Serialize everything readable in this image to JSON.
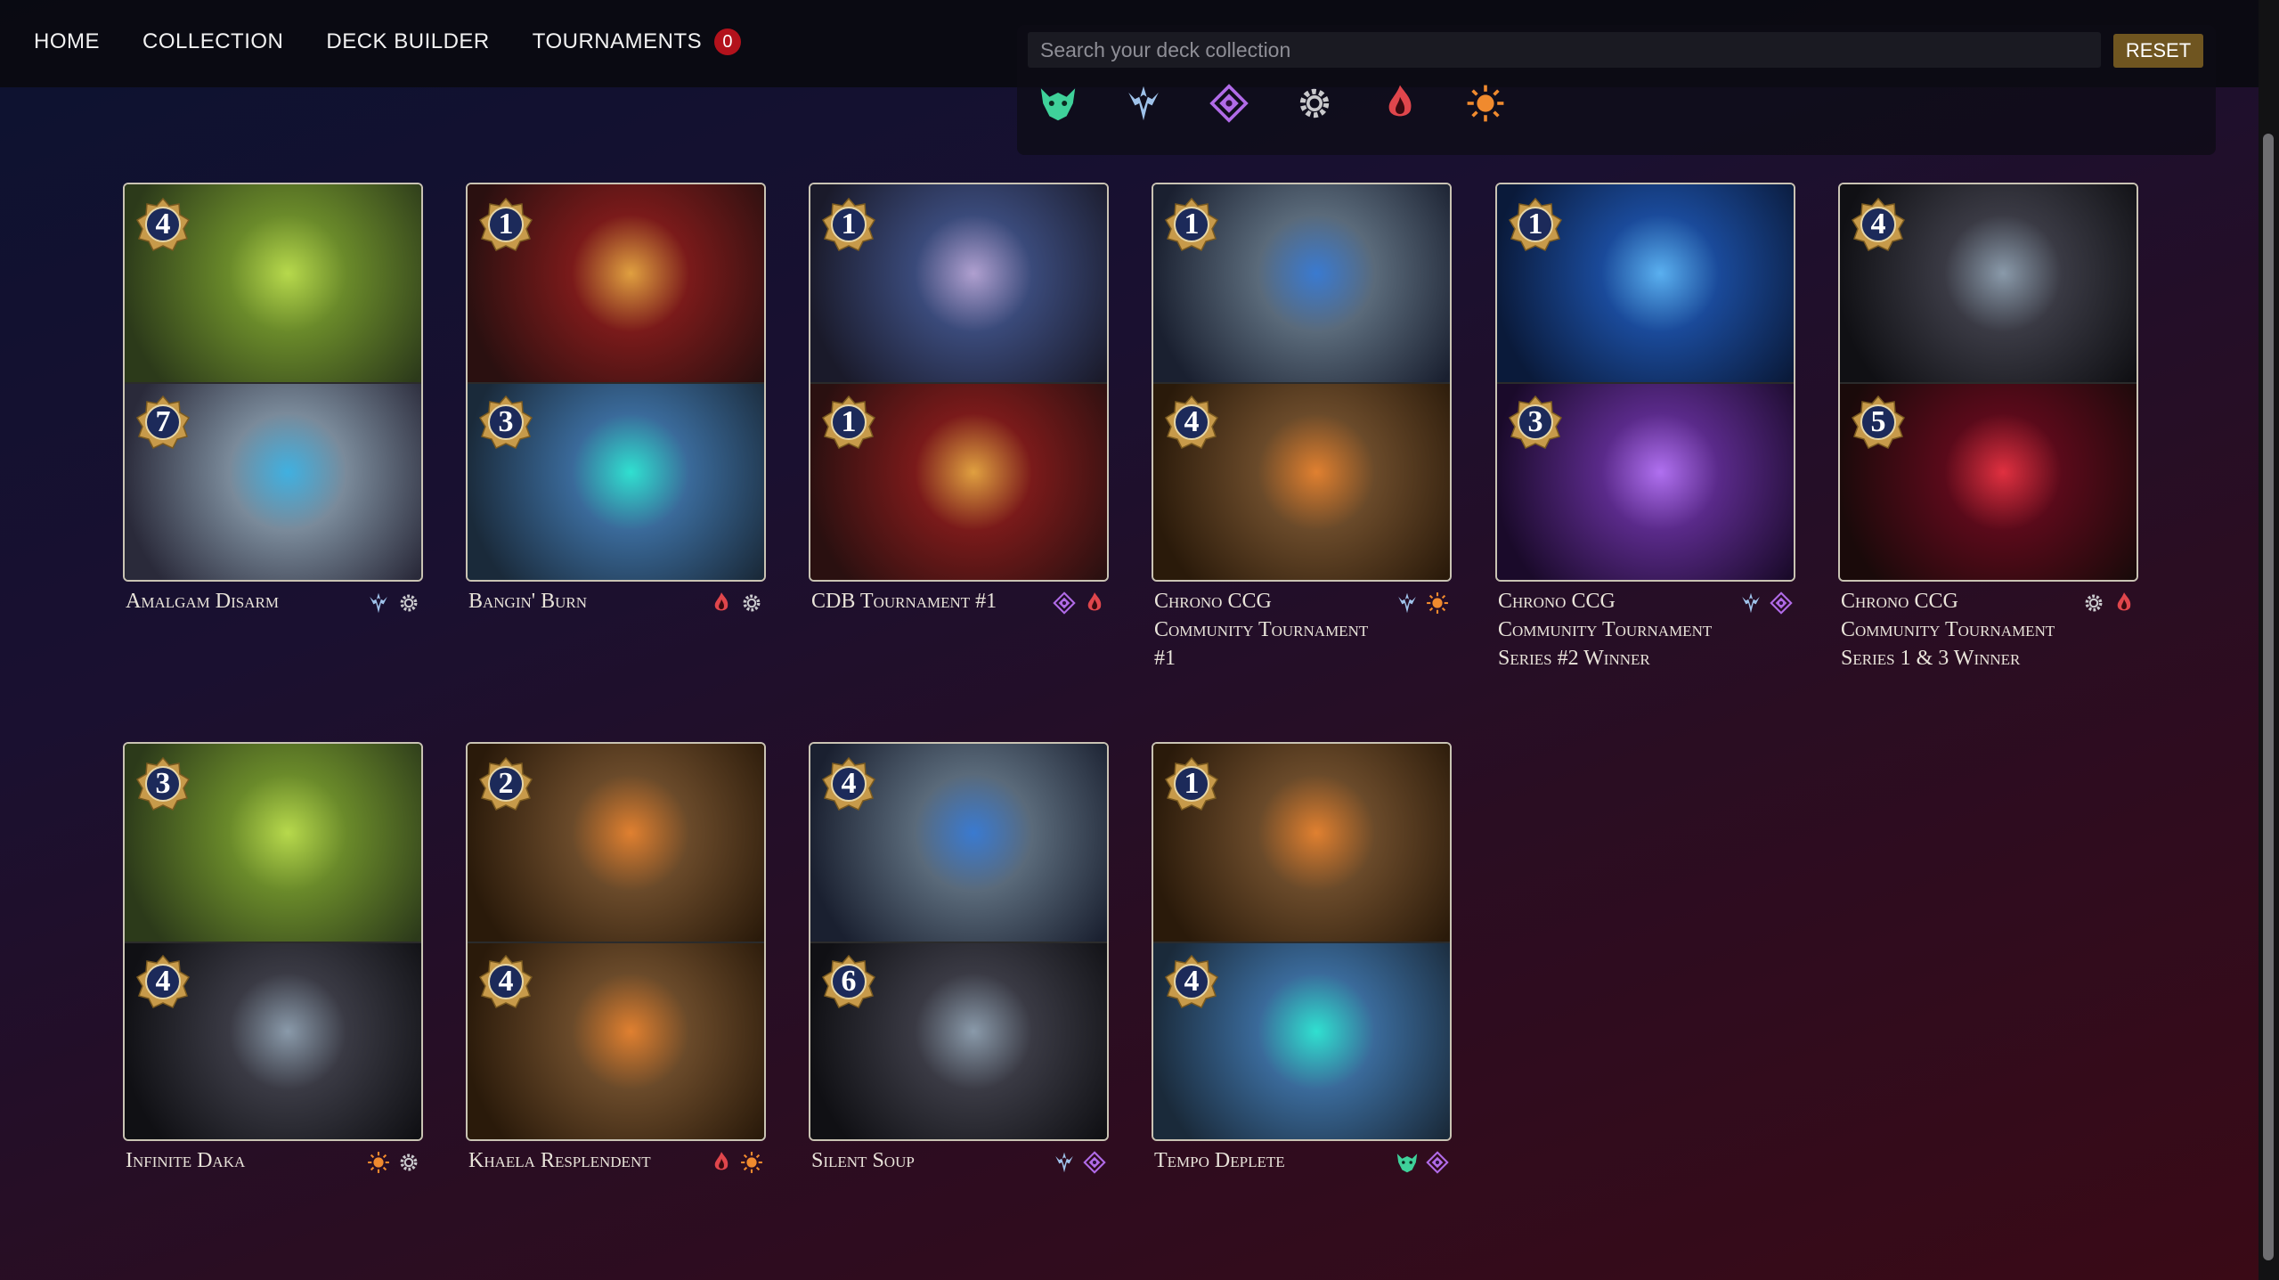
{
  "nav": {
    "items": [
      {
        "label": "HOME"
      },
      {
        "label": "COLLECTION"
      },
      {
        "label": "DECK BUILDER"
      },
      {
        "label": "TOURNAMENTS",
        "badge": "0"
      }
    ]
  },
  "search": {
    "placeholder": "Search your deck collection",
    "reset_label": "RESET"
  },
  "factions": [
    {
      "icon": "beast-faction-icon",
      "color": "#3fd19a"
    },
    {
      "icon": "trident-faction-icon",
      "color": "#9fc2ea"
    },
    {
      "icon": "arcane-faction-icon",
      "color": "#b16be8"
    },
    {
      "icon": "gear-faction-icon",
      "color": "#c9c9cc"
    },
    {
      "icon": "flame-faction-icon",
      "color": "#e0464c"
    },
    {
      "icon": "sun-faction-icon",
      "color": "#f08a2e"
    }
  ],
  "decks": [
    {
      "name": "Amalgam Disarm",
      "top_cost": "4",
      "bottom_cost": "7",
      "icons": [
        "trident-faction-icon",
        "gear-faction-icon"
      ]
    },
    {
      "name": "Bangin' Burn",
      "top_cost": "1",
      "bottom_cost": "3",
      "icons": [
        "flame-faction-icon",
        "gear-faction-icon"
      ]
    },
    {
      "name": "CDB Tournament #1",
      "top_cost": "1",
      "bottom_cost": "1",
      "icons": [
        "arcane-faction-icon",
        "flame-faction-icon"
      ]
    },
    {
      "name": "Chrono CCG Community Tournament #1",
      "top_cost": "1",
      "bottom_cost": "4",
      "icons": [
        "trident-faction-icon",
        "sun-faction-icon"
      ]
    },
    {
      "name": "Chrono CCG Community Tournament Series #2 Winner",
      "top_cost": "1",
      "bottom_cost": "3",
      "icons": [
        "trident-faction-icon",
        "arcane-faction-icon"
      ]
    },
    {
      "name": "Chrono CCG Community Tournament Series 1 & 3 Winner",
      "top_cost": "4",
      "bottom_cost": "5",
      "icons": [
        "gear-faction-icon",
        "flame-faction-icon"
      ]
    },
    {
      "name": "Infinite Daka",
      "top_cost": "3",
      "bottom_cost": "4",
      "icons": [
        "sun-faction-icon",
        "gear-faction-icon"
      ]
    },
    {
      "name": "Khaela Resplendent",
      "top_cost": "2",
      "bottom_cost": "4",
      "icons": [
        "flame-faction-icon",
        "sun-faction-icon"
      ]
    },
    {
      "name": "Silent Soup",
      "top_cost": "4",
      "bottom_cost": "6",
      "icons": [
        "trident-faction-icon",
        "arcane-faction-icon"
      ]
    },
    {
      "name": "Tempo Deplete",
      "top_cost": "1",
      "bottom_cost": "4",
      "icons": [
        "beast-faction-icon",
        "arcane-faction-icon"
      ]
    }
  ]
}
